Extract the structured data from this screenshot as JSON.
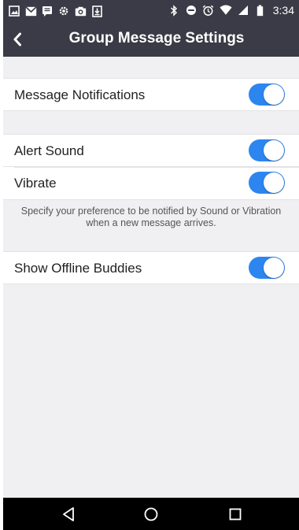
{
  "status_bar": {
    "time": "3:34",
    "left_icons": [
      "image-icon",
      "mail-icon",
      "message-icon",
      "settings-icon",
      "camera-icon",
      "download-icon"
    ],
    "right_icons": [
      "bluetooth-icon",
      "do-not-disturb-icon",
      "alarm-icon",
      "wifi-icon",
      "signal-icon",
      "battery-icon"
    ]
  },
  "header": {
    "title": "Group Message Settings",
    "back_icon": "chevron-left-icon",
    "background": "#3b3b47"
  },
  "settings": {
    "message_notifications": {
      "label": "Message Notifications",
      "enabled": true
    },
    "alert_sound": {
      "label": "Alert Sound",
      "enabled": true
    },
    "vibrate": {
      "label": "Vibrate",
      "enabled": true
    },
    "hint": "Specify your preference to be notified by Sound or Vibration when a new message arrives.",
    "show_offline_buddies": {
      "label": "Show Offline Buddies",
      "enabled": true
    }
  },
  "colors": {
    "toggle_on": "#2d86f0",
    "page_background": "#f0f0f2"
  },
  "nav_bar": {
    "icons": [
      "back-triangle-icon",
      "home-circle-icon",
      "recents-square-icon"
    ]
  }
}
